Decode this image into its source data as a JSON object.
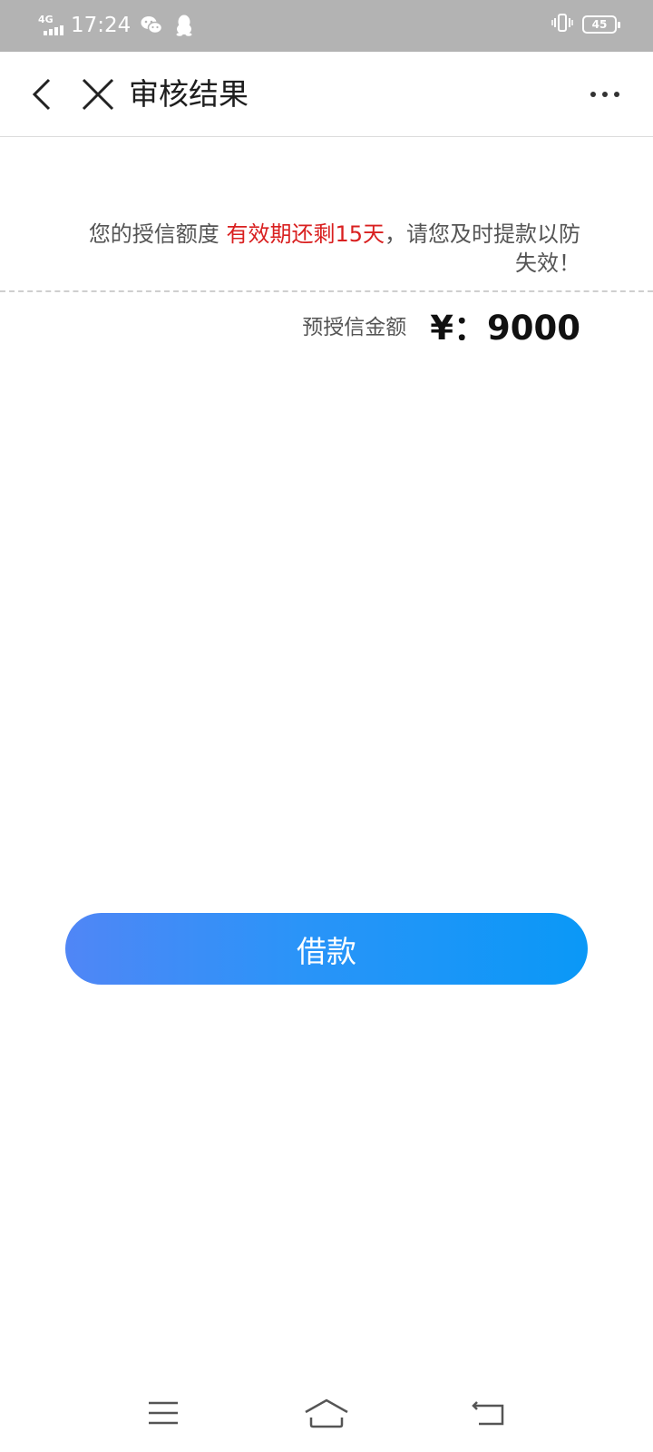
{
  "status_bar": {
    "network": "4G",
    "time": "17:24",
    "battery": "45",
    "icons": [
      "signal-icon",
      "wechat-icon",
      "qq-icon",
      "vibrate-icon",
      "battery-icon"
    ]
  },
  "nav": {
    "title": "审核结果",
    "icons": [
      "back-arrow-icon",
      "close-icon",
      "more-icon"
    ]
  },
  "notice": {
    "prefix": "您的授信额度",
    "highlight": "有效期还剩15天",
    "suffix": "，请您及时提款以防失效！"
  },
  "credit": {
    "label": "预授信金额",
    "value": "¥：9000"
  },
  "borrow_button": {
    "label": "借款"
  },
  "system_nav": {
    "icons": [
      "menu-icon",
      "home-icon",
      "back-icon"
    ]
  },
  "colors": {
    "highlight_red": "#d92020",
    "button_gradient_start": "#5086f6",
    "button_gradient_end": "#0a98f7",
    "status_bar_bg": "#b3b3b3"
  }
}
